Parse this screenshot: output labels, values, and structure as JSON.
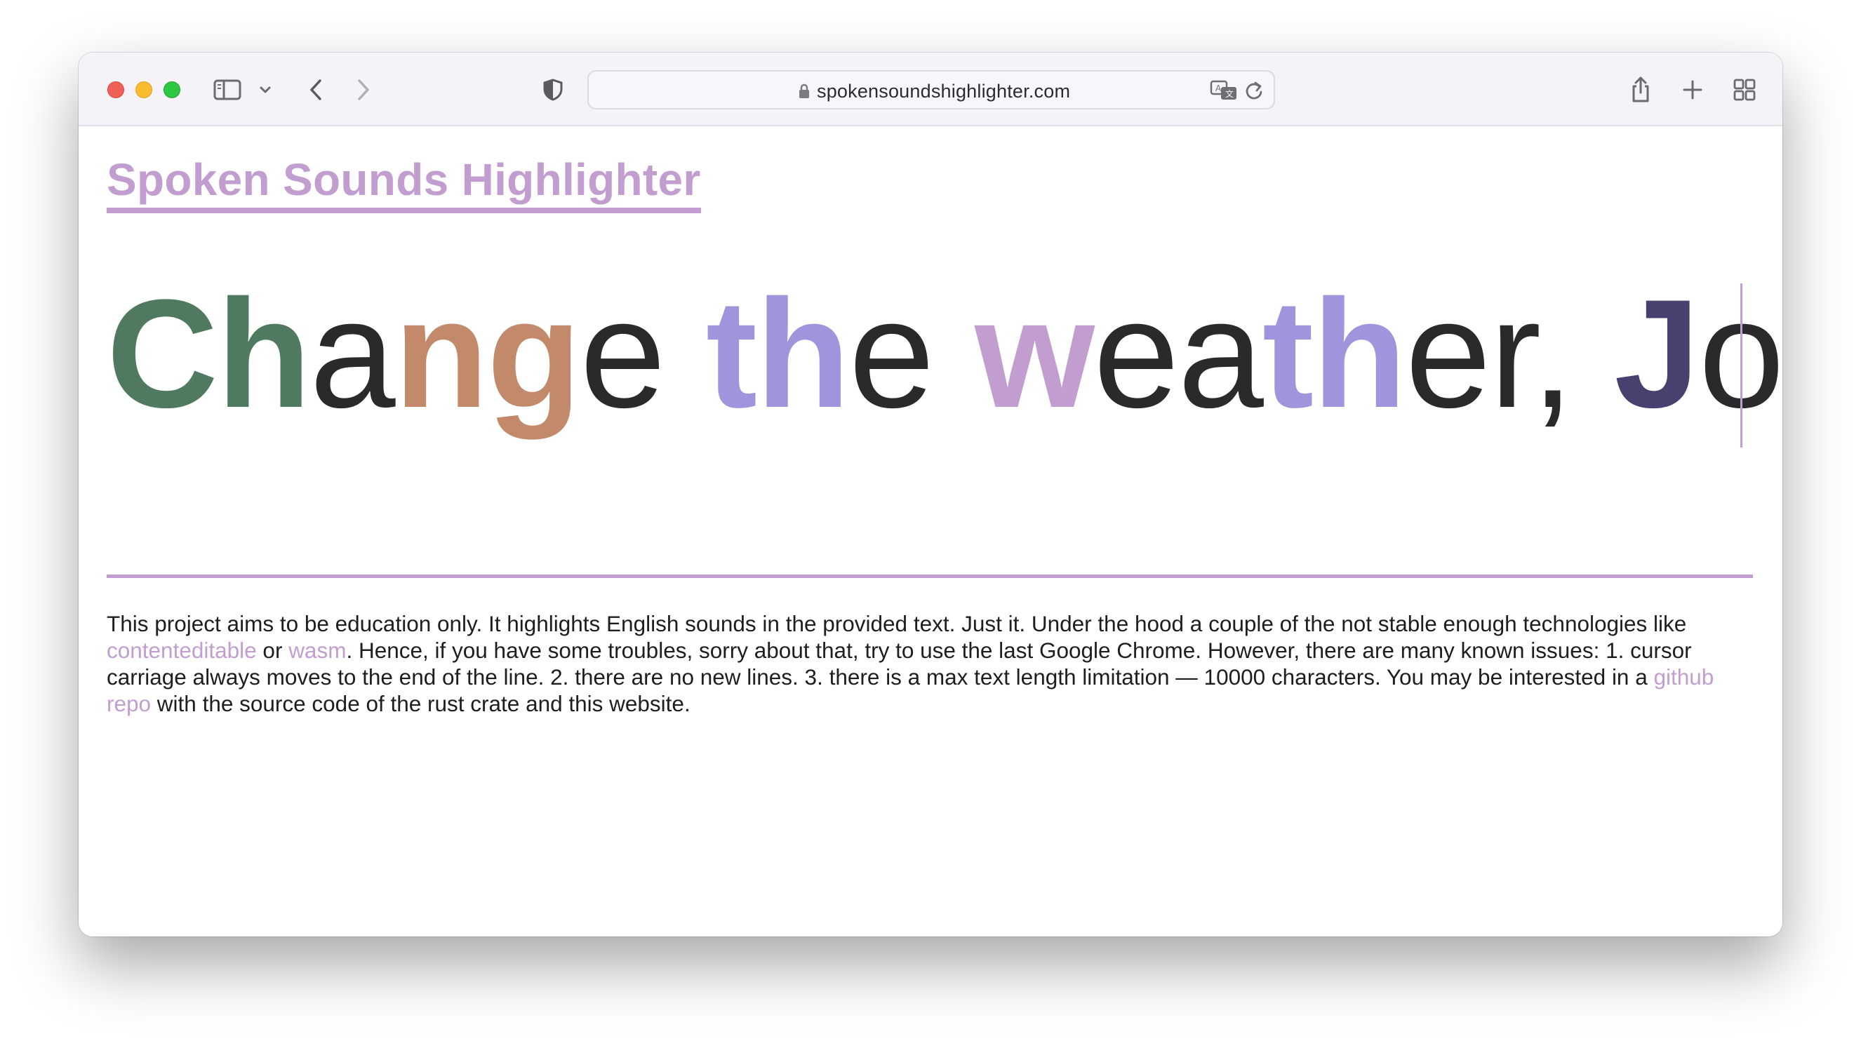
{
  "browser": {
    "url": "spokensoundshighlighter.com"
  },
  "page": {
    "title": "Spoken Sounds Highlighter",
    "editor_segments": [
      {
        "text": "Ch",
        "color": "#4f7a5f",
        "bold": true
      },
      {
        "text": "a",
        "color": "#2a2a2c",
        "bold": false
      },
      {
        "text": "ng",
        "color": "#c2896a",
        "bold": true
      },
      {
        "text": "e ",
        "color": "#2a2a2c",
        "bold": false
      },
      {
        "text": "th",
        "color": "#a094dd",
        "bold": true
      },
      {
        "text": "e ",
        "color": "#2a2a2c",
        "bold": false
      },
      {
        "text": "w",
        "color": "#c19ecf",
        "bold": true
      },
      {
        "text": "ea",
        "color": "#2a2a2c",
        "bold": false
      },
      {
        "text": "th",
        "color": "#a094dd",
        "bold": true
      },
      {
        "text": "er, ",
        "color": "#2a2a2c",
        "bold": false
      },
      {
        "text": "J",
        "color": "#48406f",
        "bold": true
      },
      {
        "text": "ohn!",
        "color": "#2a2a2c",
        "bold": false
      }
    ],
    "description": {
      "part1": "This project aims to be education only. It highlights English sounds in the provided text. Just it. Under the hood a couple of the not stable enough technologies like ",
      "link_contenteditable": "contenteditable",
      "part2": " or ",
      "link_wasm": "wasm",
      "part3": ". Hence, if you have some troubles, sorry about that, try to use the last Google Chrome. However, there are many known issues: 1. cursor carriage always moves to the end of the line. 2. there are no new lines. 3. there is a max text length limitation — 10000 characters. You may be interested in a ",
      "link_github": "github repo",
      "part4": " with the source code of the rust crate and this website."
    }
  },
  "colors": {
    "accent": "#c19ecf",
    "toolbar_bg": "#f5f2f8"
  }
}
